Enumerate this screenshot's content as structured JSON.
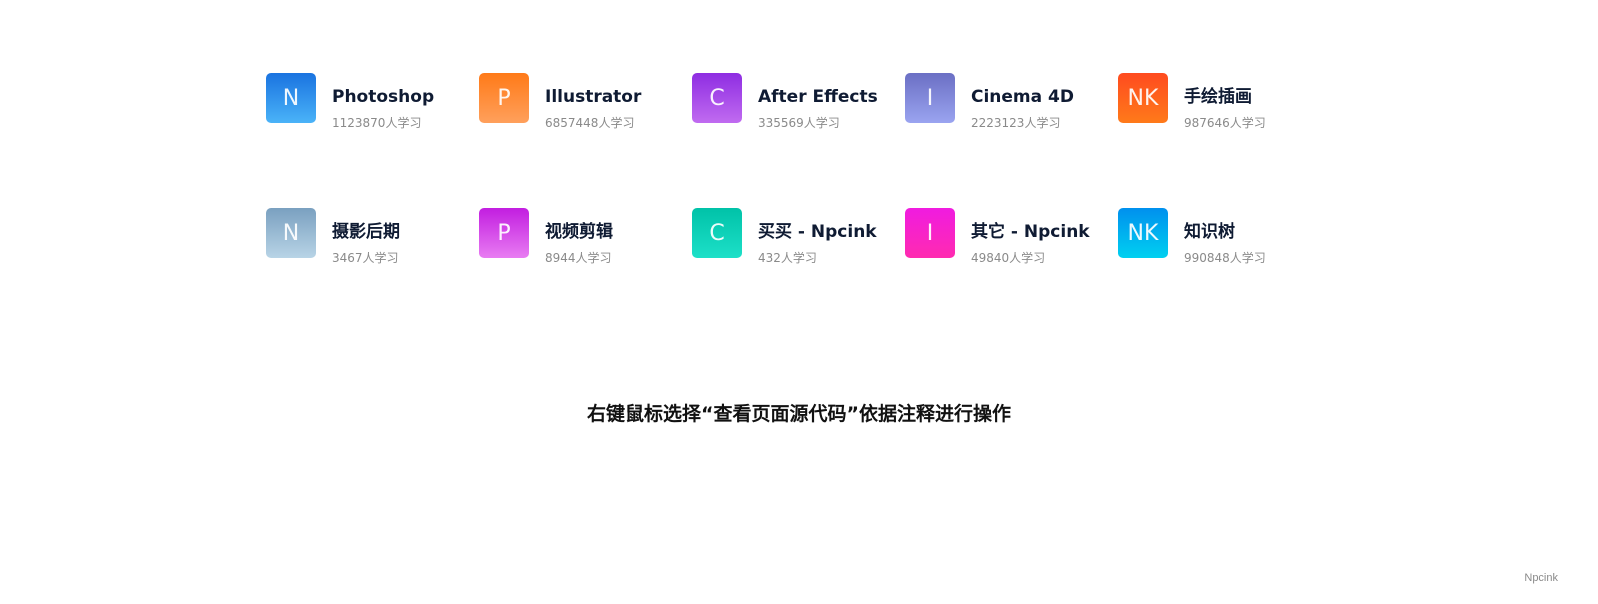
{
  "cards": [
    [
      {
        "initials": "N",
        "title": "Photoshop",
        "count": "1123870人学习",
        "gradient": [
          "#1a73e0",
          "#4ab3f8"
        ]
      },
      {
        "initials": "P",
        "title": "Illustrator",
        "count": "6857448人学习",
        "gradient": [
          "#ff7a18",
          "#ffa05c"
        ]
      },
      {
        "initials": "C",
        "title": "After Effects",
        "count": "335569人学习",
        "gradient": [
          "#8e2de2",
          "#c06bf0"
        ]
      },
      {
        "initials": "I",
        "title": "Cinema 4D",
        "count": "2223123人学习",
        "gradient": [
          "#6b6fc4",
          "#9aa4f0"
        ]
      },
      {
        "initials": "NK",
        "title": "手绘插画",
        "count": "987646人学习",
        "gradient": [
          "#ff4b1f",
          "#ff7a1a"
        ]
      }
    ],
    [
      {
        "initials": "N",
        "title": "摄影后期",
        "count": "3467人学习",
        "gradient": [
          "#7aa0c0",
          "#b8d4e6"
        ]
      },
      {
        "initials": "P",
        "title": "视频剪辑",
        "count": "8944人学习",
        "gradient": [
          "#c21ee0",
          "#e87cf2"
        ]
      },
      {
        "initials": "C",
        "title": "买买 - Npcink",
        "count": "432人学习",
        "gradient": [
          "#00c2a8",
          "#1de0c8"
        ]
      },
      {
        "initials": "I",
        "title": "其它 - Npcink",
        "count": "49840人学习",
        "gradient": [
          "#f01be0",
          "#ff2bb0"
        ]
      },
      {
        "initials": "NK",
        "title": "知识树",
        "count": "990848人学习",
        "gradient": [
          "#0090ee",
          "#00d0f0"
        ]
      }
    ]
  ],
  "notice": "右键鼠标选择“查看页面源代码”依据注释进行操作",
  "credit": "Npcink"
}
